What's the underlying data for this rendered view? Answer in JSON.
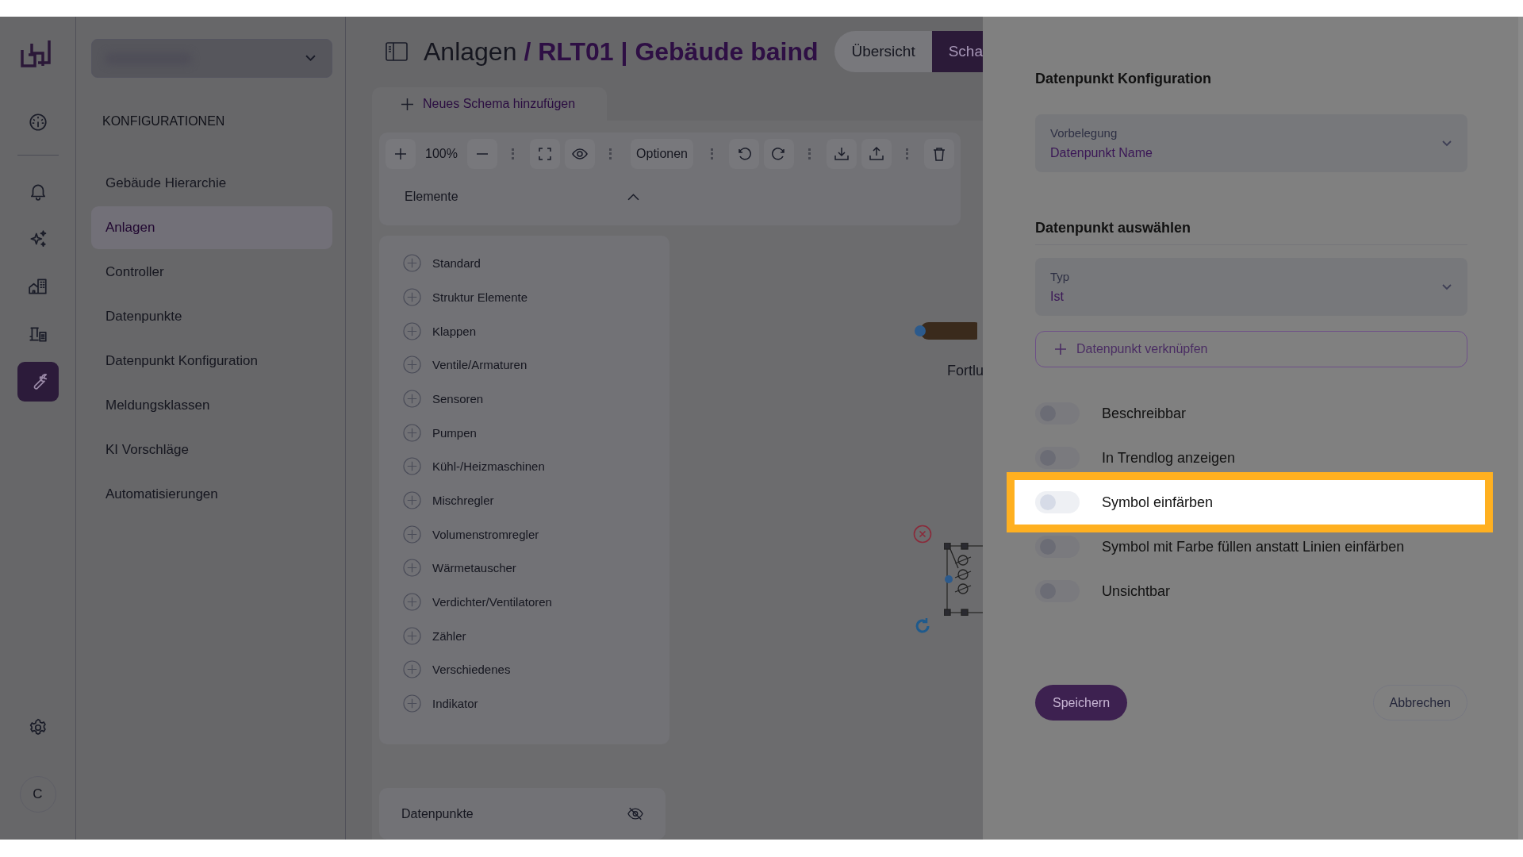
{
  "rail": {
    "items": [
      {
        "kind": "gauge",
        "selected": false
      },
      {
        "kind": "bell",
        "selected": false
      },
      {
        "kind": "sparkles",
        "selected": false
      },
      {
        "kind": "buildings",
        "selected": false
      },
      {
        "kind": "machine",
        "selected": false
      },
      {
        "kind": "wrench",
        "selected": true
      }
    ],
    "bottom": {
      "avatar": "C"
    }
  },
  "nav": {
    "heading": "KONFIGURATIONEN",
    "items": [
      {
        "label": "Gebäude Hierarchie",
        "selected": false
      },
      {
        "label": "Anlagen",
        "selected": true
      },
      {
        "label": "Controller",
        "selected": false
      },
      {
        "label": "Datenpunkte",
        "selected": false
      },
      {
        "label": "Datenpunkt Konfiguration",
        "selected": false
      },
      {
        "label": "Meldungsklassen",
        "selected": false
      },
      {
        "label": "KI Vorschläge",
        "selected": false
      },
      {
        "label": "Automatisierungen",
        "selected": false
      }
    ]
  },
  "header": {
    "title": "Anlagen",
    "subtitle": "/ RLT01 | Gebäude baind"
  },
  "view_tabs": [
    {
      "label": "Übersicht",
      "selected": false
    },
    {
      "label": "Scha",
      "selected": true
    }
  ],
  "schema_tab": {
    "label": "Neues Schema hinzufügen"
  },
  "toolbar": {
    "zoom": "100%",
    "options": "Optionen"
  },
  "elements": {
    "title": "Elemente",
    "expanded": true,
    "categories": [
      "Standard",
      "Struktur Elemente",
      "Klappen",
      "Ventile/Armaturen",
      "Sensoren",
      "Pumpen",
      "Kühl-/Heizmaschinen",
      "Mischregler",
      "Volumenstromregler",
      "Wärmetauscher",
      "Verdichter/Ventilatoren",
      "Zähler",
      "Verschiedenes",
      "Indikator"
    ]
  },
  "datapoints_panel": {
    "title": "Datenpunkte"
  },
  "canvas": {
    "label": "Fortlu"
  },
  "dialog": {
    "title": "Datenpunkt Konfiguration",
    "preset": {
      "label": "Vorbelegung",
      "value": "Datenpunkt Name"
    },
    "section": "Datenpunkt auswählen",
    "type": {
      "label": "Typ",
      "value": "Ist"
    },
    "link_button": "Datenpunkt verknüpfen",
    "toggles": [
      {
        "label": "Beschreibbar",
        "on": false,
        "highlighted": false
      },
      {
        "label": "In Trendlog anzeigen",
        "on": false,
        "highlighted": false
      },
      {
        "label": "Symbol einfärben",
        "on": false,
        "highlighted": true
      },
      {
        "label": "Symbol mit Farbe füllen anstatt Linien einfärben",
        "on": false,
        "highlighted": false
      },
      {
        "label": "Unsichtbar",
        "on": false,
        "highlighted": false
      }
    ],
    "save": "Speichern",
    "cancel": "Abbrechen"
  }
}
